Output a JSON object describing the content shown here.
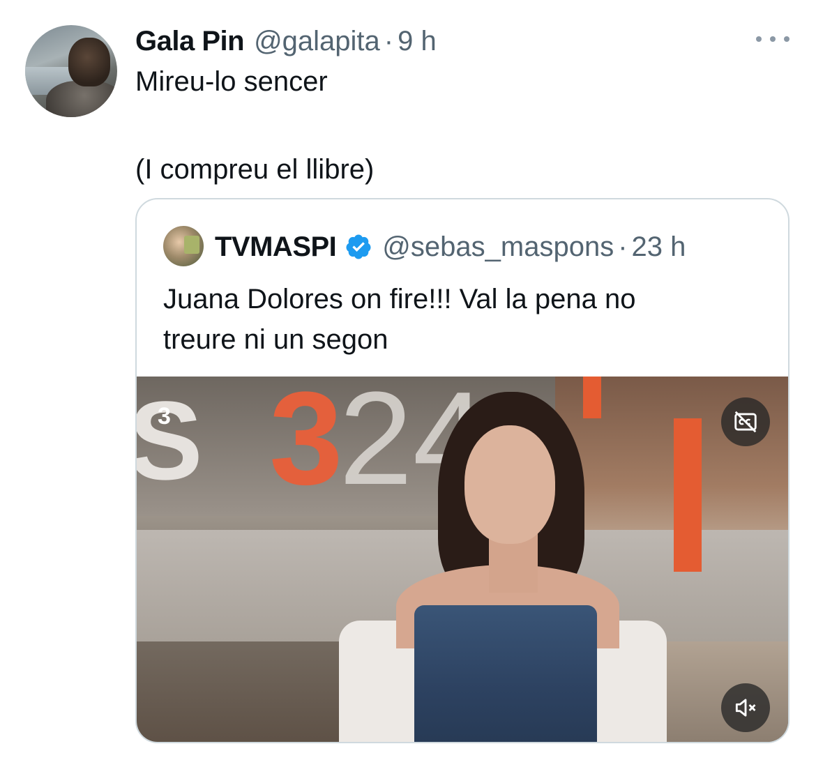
{
  "tweet": {
    "display_name": "Gala Pin",
    "handle": "@galapita",
    "separator": "·",
    "time": "9 h",
    "text_line1": "Mireu-lo sencer",
    "text_line2": "(I compreu el llibre)"
  },
  "quoted_tweet": {
    "display_name": "TVMASPI",
    "handle": "@sebas_maspons",
    "separator": "·",
    "time": "23 h",
    "text_line1": "Juana Dolores on fire!!! Val la pena no",
    "text_line2": "treure ni un segon",
    "verified": true
  },
  "media": {
    "logo_main": "3",
    "logo_secondary": "24",
    "channel_mark": "3",
    "captions_icon": "closed-captions-off-icon",
    "mute_icon": "speaker-muted-icon"
  },
  "icons": {
    "more": "more-horizontal-icon",
    "verified": "verified-badge-icon"
  },
  "colors": {
    "text": "#0f1419",
    "secondary_text": "#536471",
    "border": "#cfd9de",
    "verified_blue": "#1d9bf0",
    "channel_orange": "#e4603c"
  }
}
